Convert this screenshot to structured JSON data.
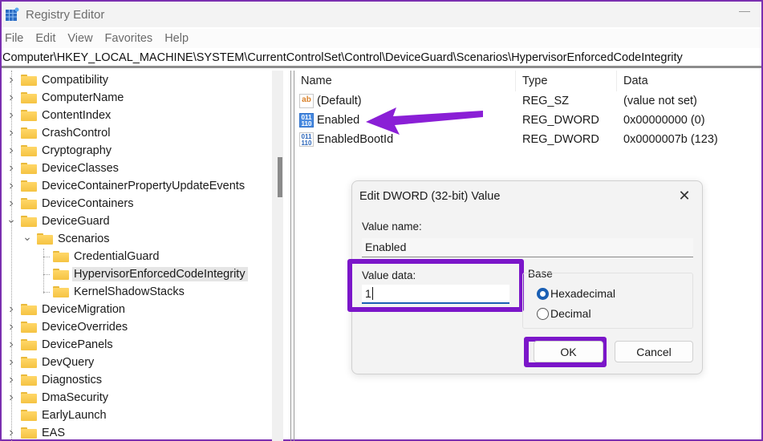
{
  "window": {
    "title": "Registry Editor"
  },
  "menu": [
    "File",
    "Edit",
    "View",
    "Favorites",
    "Help"
  ],
  "address": "Computer\\HKEY_LOCAL_MACHINE\\SYSTEM\\CurrentControlSet\\Control\\DeviceGuard\\Scenarios\\HypervisorEnforcedCodeIntegrity",
  "tree": [
    {
      "label": "Compatibility",
      "level": 0,
      "expander": "collapsed"
    },
    {
      "label": "ComputerName",
      "level": 0,
      "expander": "collapsed"
    },
    {
      "label": "ContentIndex",
      "level": 0,
      "expander": "collapsed"
    },
    {
      "label": "CrashControl",
      "level": 0,
      "expander": "collapsed"
    },
    {
      "label": "Cryptography",
      "level": 0,
      "expander": "collapsed"
    },
    {
      "label": "DeviceClasses",
      "level": 0,
      "expander": "collapsed"
    },
    {
      "label": "DeviceContainerPropertyUpdateEvents",
      "level": 0,
      "expander": "collapsed"
    },
    {
      "label": "DeviceContainers",
      "level": 0,
      "expander": "collapsed"
    },
    {
      "label": "DeviceGuard",
      "level": 0,
      "expander": "expanded"
    },
    {
      "label": "Scenarios",
      "level": 1,
      "expander": "expanded"
    },
    {
      "label": "CredentialGuard",
      "level": 2,
      "expander": "none"
    },
    {
      "label": "HypervisorEnforcedCodeIntegrity",
      "level": 2,
      "expander": "none",
      "selected": true
    },
    {
      "label": "KernelShadowStacks",
      "level": 2,
      "expander": "none"
    },
    {
      "label": "DeviceMigration",
      "level": 0,
      "expander": "collapsed"
    },
    {
      "label": "DeviceOverrides",
      "level": 0,
      "expander": "collapsed"
    },
    {
      "label": "DevicePanels",
      "level": 0,
      "expander": "collapsed"
    },
    {
      "label": "DevQuery",
      "level": 0,
      "expander": "collapsed"
    },
    {
      "label": "Diagnostics",
      "level": 0,
      "expander": "collapsed"
    },
    {
      "label": "DmaSecurity",
      "level": 0,
      "expander": "collapsed"
    },
    {
      "label": "EarlyLaunch",
      "level": 0,
      "expander": "none"
    },
    {
      "label": "EAS",
      "level": 0,
      "expander": "collapsed"
    }
  ],
  "list": {
    "columns": [
      "Name",
      "Type",
      "Data"
    ],
    "rows": [
      {
        "icon": "string-value-icon",
        "name": "(Default)",
        "type": "REG_SZ",
        "data": "(value not set)"
      },
      {
        "icon": "dword-value-icon",
        "name": "Enabled",
        "type": "REG_DWORD",
        "data": "0x00000000 (0)",
        "selected": true
      },
      {
        "icon": "dword-value-icon",
        "name": "EnabledBootId",
        "type": "REG_DWORD",
        "data": "0x0000007b (123)"
      }
    ]
  },
  "dialog": {
    "title": "Edit DWORD (32-bit) Value",
    "value_name_label": "Value name:",
    "value_name": "Enabled",
    "value_data_label": "Value data:",
    "value_data": "1",
    "base_label": "Base",
    "base_options": [
      {
        "label": "Hexadecimal",
        "checked": true
      },
      {
        "label": "Decimal",
        "checked": false
      }
    ],
    "ok_label": "OK",
    "cancel_label": "Cancel"
  },
  "annotations": {
    "highlight_color": "#7b16c9",
    "arrow_target": "Enabled"
  },
  "icons": {
    "dword": "011\n110",
    "string": "ab"
  }
}
